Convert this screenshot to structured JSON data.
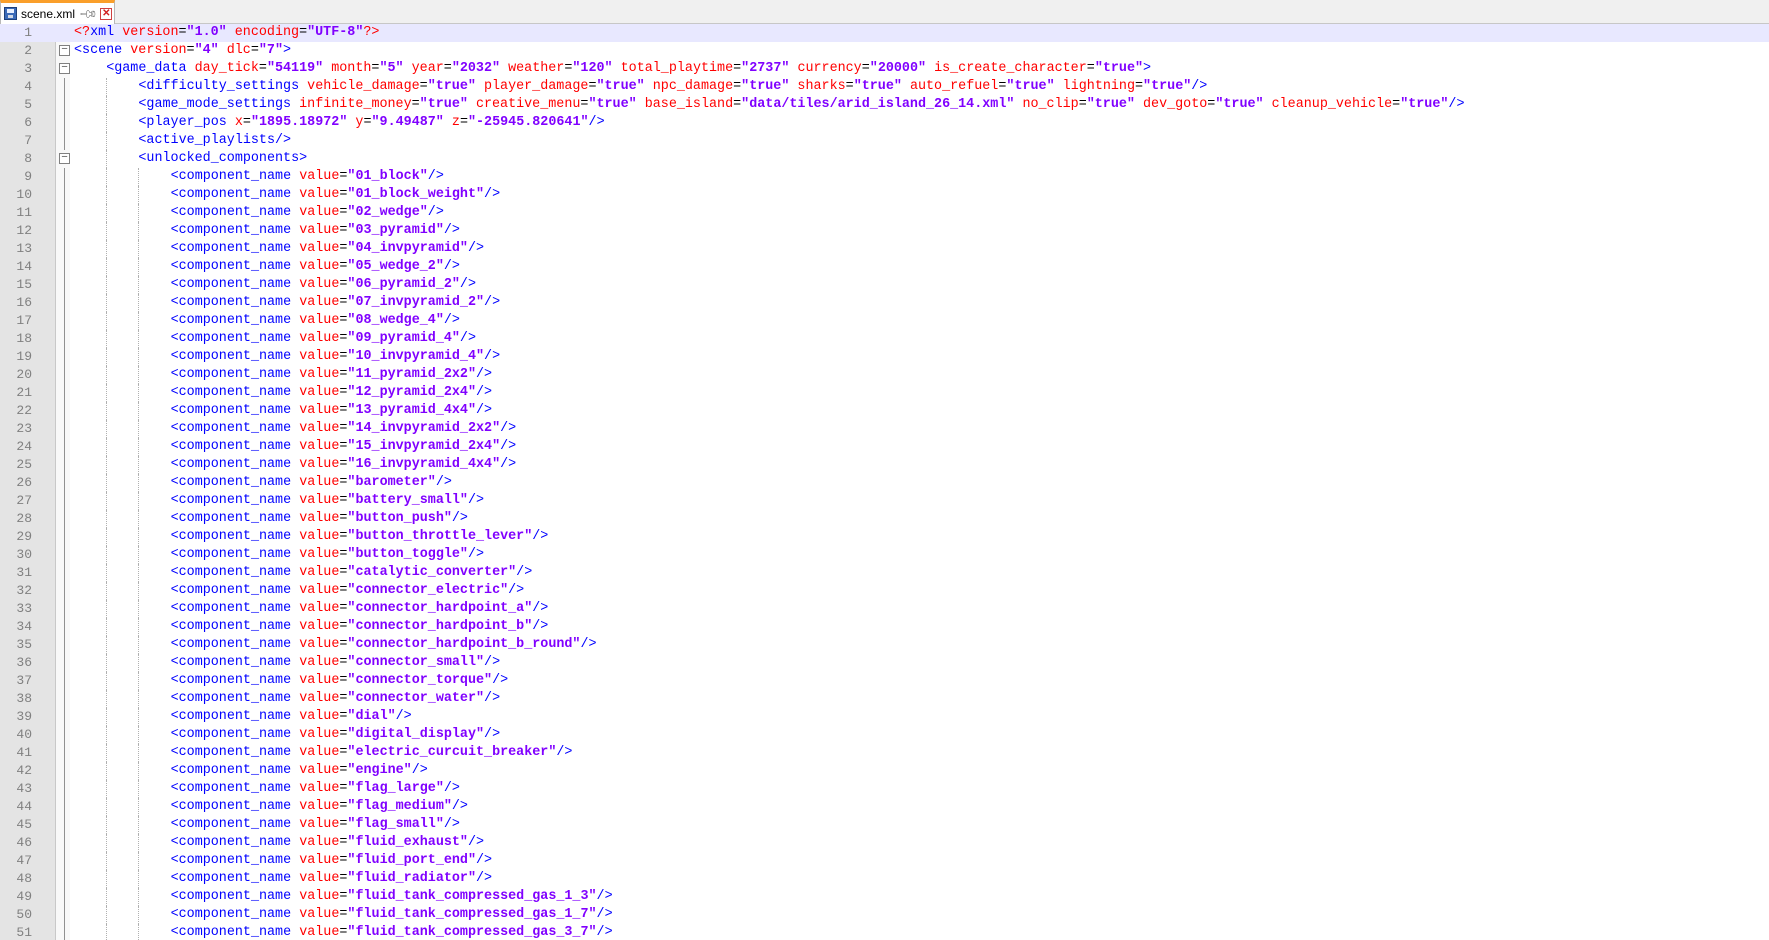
{
  "tab": {
    "filename": "scene.xml",
    "pin_icon": "pin-icon",
    "close_icon": "close-icon",
    "save_icon": "save-icon",
    "accent_color": "#fa9f2a"
  },
  "colors": {
    "tag": "#0000ff",
    "attribute": "#ff0000",
    "value": "#8000ff",
    "current_line_bg": "#e8e8ff",
    "gutter_bg": "#e4e4e4"
  },
  "current_line": 1,
  "lines": [
    {
      "n": 1,
      "indent": 0,
      "fold": "",
      "tokens": [
        [
          "pi",
          "<?"
        ],
        [
          "tag",
          "xml"
        ],
        [
          "sp",
          " "
        ],
        [
          "attr",
          "version"
        ],
        [
          "eq",
          "="
        ],
        [
          "val",
          "\"1.0\""
        ],
        [
          "sp",
          " "
        ],
        [
          "attr",
          "encoding"
        ],
        [
          "eq",
          "="
        ],
        [
          "val",
          "\"UTF-8\""
        ],
        [
          "pi",
          "?>"
        ]
      ]
    },
    {
      "n": 2,
      "indent": 0,
      "fold": "open",
      "tokens": [
        [
          "tag",
          "<scene"
        ],
        [
          "sp",
          " "
        ],
        [
          "attr",
          "version"
        ],
        [
          "eq",
          "="
        ],
        [
          "val",
          "\"4\""
        ],
        [
          "sp",
          " "
        ],
        [
          "attr",
          "dlc"
        ],
        [
          "eq",
          "="
        ],
        [
          "val",
          "\"7\""
        ],
        [
          "tag",
          ">"
        ]
      ]
    },
    {
      "n": 3,
      "indent": 1,
      "fold": "open",
      "tokens": [
        [
          "tag",
          "<game_data"
        ],
        [
          "sp",
          " "
        ],
        [
          "attr",
          "day_tick"
        ],
        [
          "eq",
          "="
        ],
        [
          "val",
          "\"54119\""
        ],
        [
          "sp",
          " "
        ],
        [
          "attr",
          "month"
        ],
        [
          "eq",
          "="
        ],
        [
          "val",
          "\"5\""
        ],
        [
          "sp",
          " "
        ],
        [
          "attr",
          "year"
        ],
        [
          "eq",
          "="
        ],
        [
          "val",
          "\"2032\""
        ],
        [
          "sp",
          " "
        ],
        [
          "attr",
          "weather"
        ],
        [
          "eq",
          "="
        ],
        [
          "val",
          "\"120\""
        ],
        [
          "sp",
          " "
        ],
        [
          "attr",
          "total_playtime"
        ],
        [
          "eq",
          "="
        ],
        [
          "val",
          "\"2737\""
        ],
        [
          "sp",
          " "
        ],
        [
          "attr",
          "currency"
        ],
        [
          "eq",
          "="
        ],
        [
          "val",
          "\"20000\""
        ],
        [
          "sp",
          " "
        ],
        [
          "attr",
          "is_create_character"
        ],
        [
          "eq",
          "="
        ],
        [
          "val",
          "\"true\""
        ],
        [
          "tag",
          ">"
        ]
      ]
    },
    {
      "n": 4,
      "indent": 2,
      "fold": "",
      "tokens": [
        [
          "tag",
          "<difficulty_settings"
        ],
        [
          "sp",
          " "
        ],
        [
          "attr",
          "vehicle_damage"
        ],
        [
          "eq",
          "="
        ],
        [
          "val",
          "\"true\""
        ],
        [
          "sp",
          " "
        ],
        [
          "attr",
          "player_damage"
        ],
        [
          "eq",
          "="
        ],
        [
          "val",
          "\"true\""
        ],
        [
          "sp",
          " "
        ],
        [
          "attr",
          "npc_damage"
        ],
        [
          "eq",
          "="
        ],
        [
          "val",
          "\"true\""
        ],
        [
          "sp",
          " "
        ],
        [
          "attr",
          "sharks"
        ],
        [
          "eq",
          "="
        ],
        [
          "val",
          "\"true\""
        ],
        [
          "sp",
          " "
        ],
        [
          "attr",
          "auto_refuel"
        ],
        [
          "eq",
          "="
        ],
        [
          "val",
          "\"true\""
        ],
        [
          "sp",
          " "
        ],
        [
          "attr",
          "lightning"
        ],
        [
          "eq",
          "="
        ],
        [
          "val",
          "\"true\""
        ],
        [
          "tag",
          "/>"
        ]
      ]
    },
    {
      "n": 5,
      "indent": 2,
      "fold": "",
      "tokens": [
        [
          "tag",
          "<game_mode_settings"
        ],
        [
          "sp",
          " "
        ],
        [
          "attr",
          "infinite_money"
        ],
        [
          "eq",
          "="
        ],
        [
          "val",
          "\"true\""
        ],
        [
          "sp",
          " "
        ],
        [
          "attr",
          "creative_menu"
        ],
        [
          "eq",
          "="
        ],
        [
          "val",
          "\"true\""
        ],
        [
          "sp",
          " "
        ],
        [
          "attr",
          "base_island"
        ],
        [
          "eq",
          "="
        ],
        [
          "val",
          "\"data/tiles/arid_island_26_14.xml\""
        ],
        [
          "sp",
          " "
        ],
        [
          "attr",
          "no_clip"
        ],
        [
          "eq",
          "="
        ],
        [
          "val",
          "\"true\""
        ],
        [
          "sp",
          " "
        ],
        [
          "attr",
          "dev_goto"
        ],
        [
          "eq",
          "="
        ],
        [
          "val",
          "\"true\""
        ],
        [
          "sp",
          " "
        ],
        [
          "attr",
          "cleanup_vehicle"
        ],
        [
          "eq",
          "="
        ],
        [
          "val",
          "\"true\""
        ],
        [
          "tag",
          "/>"
        ]
      ]
    },
    {
      "n": 6,
      "indent": 2,
      "fold": "",
      "tokens": [
        [
          "tag",
          "<player_pos"
        ],
        [
          "sp",
          " "
        ],
        [
          "attr",
          "x"
        ],
        [
          "eq",
          "="
        ],
        [
          "val",
          "\"1895.18972\""
        ],
        [
          "sp",
          " "
        ],
        [
          "attr",
          "y"
        ],
        [
          "eq",
          "="
        ],
        [
          "val",
          "\"9.49487\""
        ],
        [
          "sp",
          " "
        ],
        [
          "attr",
          "z"
        ],
        [
          "eq",
          "="
        ],
        [
          "val",
          "\"-25945.820641\""
        ],
        [
          "tag",
          "/>"
        ]
      ]
    },
    {
      "n": 7,
      "indent": 2,
      "fold": "",
      "tokens": [
        [
          "tag",
          "<active_playlists/>"
        ]
      ]
    },
    {
      "n": 8,
      "indent": 2,
      "fold": "open",
      "tokens": [
        [
          "tag",
          "<unlocked_components>"
        ]
      ]
    },
    {
      "n": 9,
      "indent": 3,
      "fold": "",
      "component": "01_block"
    },
    {
      "n": 10,
      "indent": 3,
      "fold": "",
      "component": "01_block_weight"
    },
    {
      "n": 11,
      "indent": 3,
      "fold": "",
      "component": "02_wedge"
    },
    {
      "n": 12,
      "indent": 3,
      "fold": "",
      "component": "03_pyramid"
    },
    {
      "n": 13,
      "indent": 3,
      "fold": "",
      "component": "04_invpyramid"
    },
    {
      "n": 14,
      "indent": 3,
      "fold": "",
      "component": "05_wedge_2"
    },
    {
      "n": 15,
      "indent": 3,
      "fold": "",
      "component": "06_pyramid_2"
    },
    {
      "n": 16,
      "indent": 3,
      "fold": "",
      "component": "07_invpyramid_2"
    },
    {
      "n": 17,
      "indent": 3,
      "fold": "",
      "component": "08_wedge_4"
    },
    {
      "n": 18,
      "indent": 3,
      "fold": "",
      "component": "09_pyramid_4"
    },
    {
      "n": 19,
      "indent": 3,
      "fold": "",
      "component": "10_invpyramid_4"
    },
    {
      "n": 20,
      "indent": 3,
      "fold": "",
      "component": "11_pyramid_2x2"
    },
    {
      "n": 21,
      "indent": 3,
      "fold": "",
      "component": "12_pyramid_2x4"
    },
    {
      "n": 22,
      "indent": 3,
      "fold": "",
      "component": "13_pyramid_4x4"
    },
    {
      "n": 23,
      "indent": 3,
      "fold": "",
      "component": "14_invpyramid_2x2"
    },
    {
      "n": 24,
      "indent": 3,
      "fold": "",
      "component": "15_invpyramid_2x4"
    },
    {
      "n": 25,
      "indent": 3,
      "fold": "",
      "component": "16_invpyramid_4x4"
    },
    {
      "n": 26,
      "indent": 3,
      "fold": "",
      "component": "barometer"
    },
    {
      "n": 27,
      "indent": 3,
      "fold": "",
      "component": "battery_small"
    },
    {
      "n": 28,
      "indent": 3,
      "fold": "",
      "component": "button_push"
    },
    {
      "n": 29,
      "indent": 3,
      "fold": "",
      "component": "button_throttle_lever"
    },
    {
      "n": 30,
      "indent": 3,
      "fold": "",
      "component": "button_toggle"
    },
    {
      "n": 31,
      "indent": 3,
      "fold": "",
      "component": "catalytic_converter"
    },
    {
      "n": 32,
      "indent": 3,
      "fold": "",
      "component": "connector_electric"
    },
    {
      "n": 33,
      "indent": 3,
      "fold": "",
      "component": "connector_hardpoint_a"
    },
    {
      "n": 34,
      "indent": 3,
      "fold": "",
      "component": "connector_hardpoint_b"
    },
    {
      "n": 35,
      "indent": 3,
      "fold": "",
      "component": "connector_hardpoint_b_round"
    },
    {
      "n": 36,
      "indent": 3,
      "fold": "",
      "component": "connector_small"
    },
    {
      "n": 37,
      "indent": 3,
      "fold": "",
      "component": "connector_torque"
    },
    {
      "n": 38,
      "indent": 3,
      "fold": "",
      "component": "connector_water"
    },
    {
      "n": 39,
      "indent": 3,
      "fold": "",
      "component": "dial"
    },
    {
      "n": 40,
      "indent": 3,
      "fold": "",
      "component": "digital_display"
    },
    {
      "n": 41,
      "indent": 3,
      "fold": "",
      "component": "electric_curcuit_breaker"
    },
    {
      "n": 42,
      "indent": 3,
      "fold": "",
      "component": "engine"
    },
    {
      "n": 43,
      "indent": 3,
      "fold": "",
      "component": "flag_large"
    },
    {
      "n": 44,
      "indent": 3,
      "fold": "",
      "component": "flag_medium"
    },
    {
      "n": 45,
      "indent": 3,
      "fold": "",
      "component": "flag_small"
    },
    {
      "n": 46,
      "indent": 3,
      "fold": "",
      "component": "fluid_exhaust"
    },
    {
      "n": 47,
      "indent": 3,
      "fold": "",
      "component": "fluid_port_end"
    },
    {
      "n": 48,
      "indent": 3,
      "fold": "",
      "component": "fluid_radiator"
    },
    {
      "n": 49,
      "indent": 3,
      "fold": "",
      "component": "fluid_tank_compressed_gas_1_3"
    },
    {
      "n": 50,
      "indent": 3,
      "fold": "",
      "component": "fluid_tank_compressed_gas_1_7"
    },
    {
      "n": 51,
      "indent": 3,
      "fold": "",
      "component": "fluid_tank_compressed_gas_3_7"
    }
  ]
}
